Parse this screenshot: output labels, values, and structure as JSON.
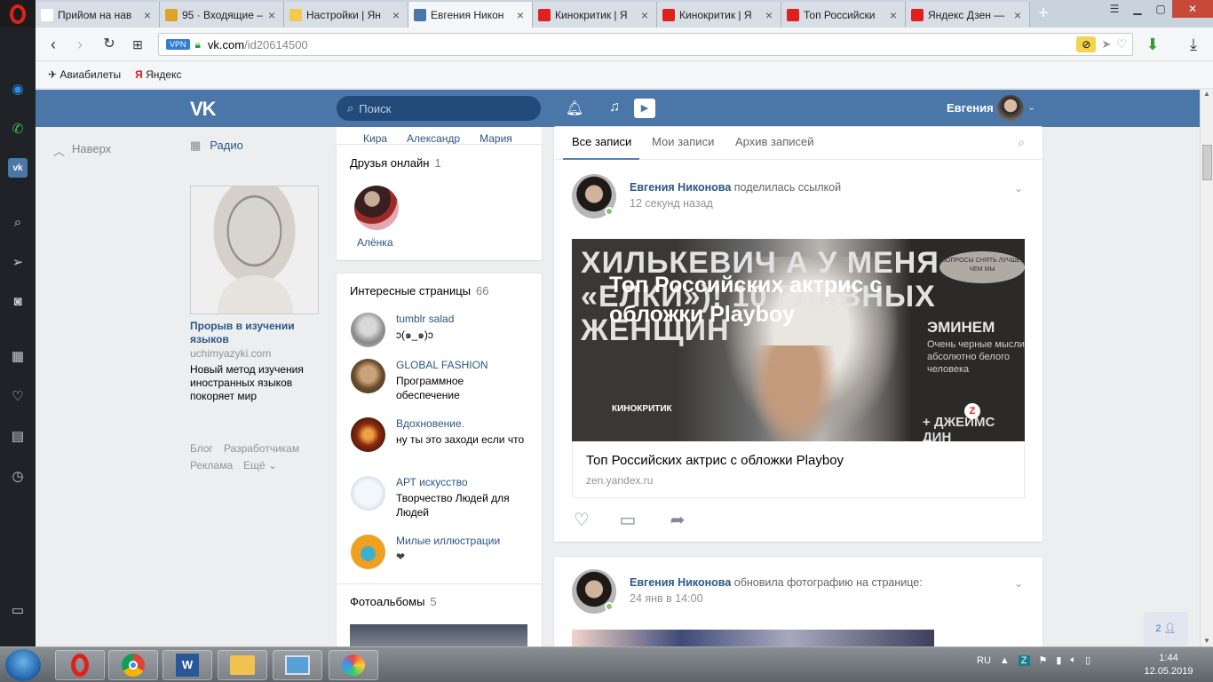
{
  "browser": {
    "tabs": [
      {
        "title": "Прийом на нав",
        "icon": "document-icon",
        "color": "#ffffff"
      },
      {
        "title": "95 · Входящие –",
        "icon": "mail-icon",
        "color": "#e0a22a"
      },
      {
        "title": "Настройки | Ян",
        "icon": "settings-icon",
        "color": "#f2c94c"
      },
      {
        "title": "Евгения Никон",
        "icon": "vk-icon",
        "color": "#4a76a8"
      },
      {
        "title": "Кинокритик | Я",
        "icon": "zen-icon",
        "color": "#e0201d"
      },
      {
        "title": "Кинокритик | Я",
        "icon": "zen-icon",
        "color": "#e0201d"
      },
      {
        "title": "Топ Российски",
        "icon": "zen-icon",
        "color": "#e0201d"
      },
      {
        "title": "Яндекс Дзен —",
        "icon": "zen-icon",
        "color": "#e0201d"
      }
    ],
    "active_tab": 3,
    "vpn_label": "VPN",
    "url_host": "vk.com",
    "url_path": "/id20614500",
    "bookmarks": [
      {
        "label": "Авиабилеты",
        "icon": "plane-icon"
      },
      {
        "label": "Яндекс",
        "icon": "yandex-icon"
      }
    ]
  },
  "vk": {
    "search_placeholder": "Поиск",
    "user_name": "Евгения",
    "up_label": "Наверх",
    "radio_label": "Радио",
    "ad": {
      "title": "Прорыв в изучении языков",
      "domain": "uchimyazyki.com",
      "description": "Новый метод изучения иностранных языков покоряет мир"
    },
    "footer_links": [
      "Блог",
      "Разработчикам",
      "Реклама",
      "Ещё ⌄"
    ],
    "friends_cut": [
      "Кира",
      "Александр",
      "Мария"
    ],
    "friends_online": {
      "title": "Друзья онлайн",
      "count": "1",
      "friend_name": "Алёнка"
    },
    "pages": {
      "title": "Интересные страницы",
      "count": "66",
      "items": [
        {
          "name": "tumblr salad",
          "desc": "ↄ(๑ ̲ ๑)ↄ"
        },
        {
          "name": "GLOBAL FASHION",
          "desc": "Программное обеспечение"
        },
        {
          "name": "Вдохновение.",
          "desc": "ну ты это заходи если что"
        },
        {
          "name": "АРТ искусство",
          "desc": "Творчество Людей для Людей"
        },
        {
          "name": "Милые иллюстрации",
          "desc": "❤"
        }
      ]
    },
    "photos": {
      "title": "Фотоальбомы",
      "count": "5"
    },
    "wall": {
      "tabs": [
        "Все записи",
        "Мои записи",
        "Архив записей"
      ],
      "active_tab": 0,
      "posts": [
        {
          "author": "Евгения Никонова",
          "action": "поделилась ссылкой",
          "time": "12 секунд назад",
          "link": {
            "image_headline": "Топ Российских актрис с обложки Playboy",
            "image_left_text": "ХИЛЬКЕВИЧ А У МЕНЯ «ЕЛКИ»)! 10 ГЛАВНЫХ ЖЕНЩИН",
            "image_brand": "КИНОКРИТИК",
            "image_right_title": "ЭМИНЕМ",
            "image_right_text": "Очень черные мысли абсолютно белого человека",
            "image_badge": "ВОПРОСЫ СНЯТЬ ЛУЧШЕ, ЧЕМ МЫ",
            "image_bottom_right": "+ ДЖЕЙМС ДИН",
            "zen_mark": "Z",
            "title": "Топ Российских актрис с обложки Playboy",
            "domain": "zen.yandex.ru"
          }
        },
        {
          "author": "Евгения Никонова",
          "action": "обновила фотографию на странице:",
          "time": "24 янв в 14:00"
        }
      ]
    },
    "friends_badge": "2"
  },
  "taskbar": {
    "lang": "RU",
    "time": "1:44",
    "date": "12.05.2019"
  }
}
